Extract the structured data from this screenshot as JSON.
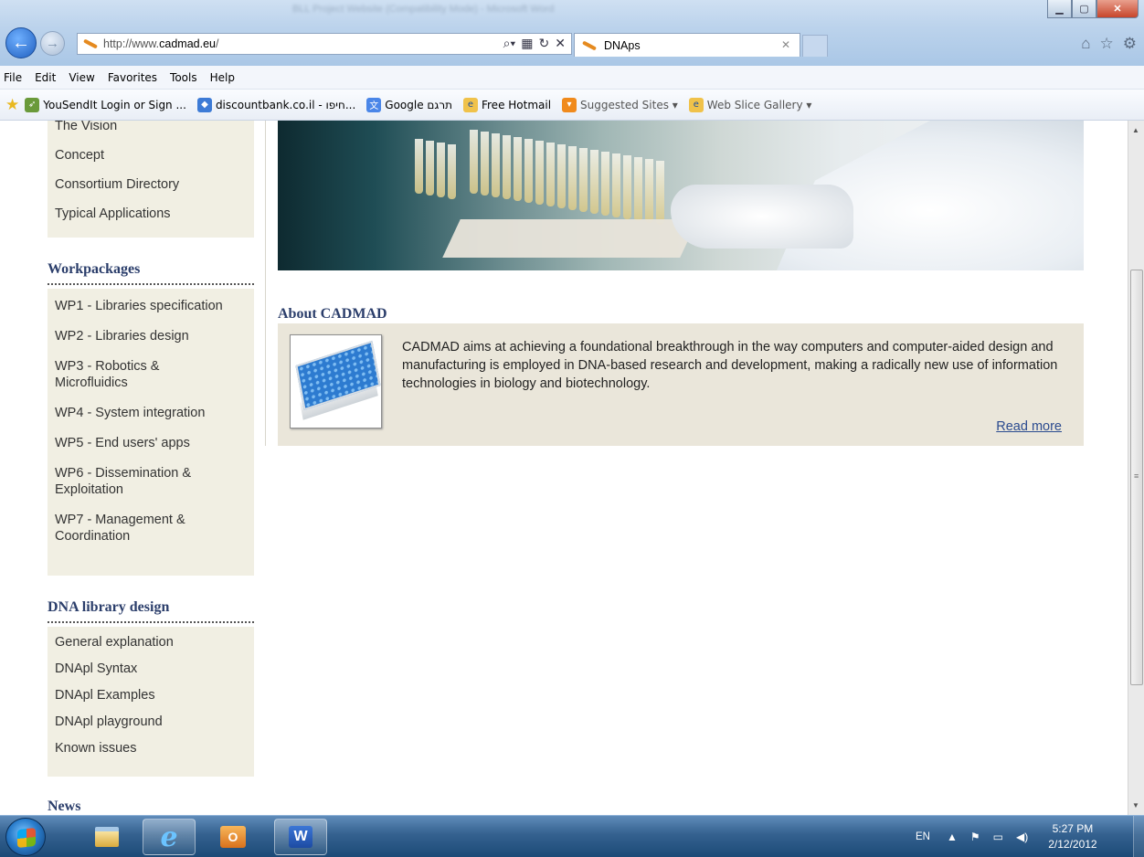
{
  "browser": {
    "window_title": "BLL Project Website (Compatibility Mode) - Microsoft Word",
    "address": {
      "prefix": "http://www.",
      "domain": "cadmad.eu",
      "suffix": "/"
    },
    "tab_title": "DNAps",
    "menu": [
      "File",
      "Edit",
      "View",
      "Favorites",
      "Tools",
      "Help"
    ],
    "favorites": [
      {
        "label": "YouSendIt Login or Sign ...",
        "icon": "yousendit-icon"
      },
      {
        "label": "discountbank.co.il - חיפו...",
        "icon": "discountbank-icon"
      },
      {
        "label": "Google תרגם",
        "icon": "google-translate-icon"
      },
      {
        "label": "Free Hotmail",
        "icon": "ie-page-icon"
      },
      {
        "label": "Suggested Sites ▾",
        "icon": "suggested-sites-icon"
      },
      {
        "label": "Web Slice Gallery ▾",
        "icon": "ie-page-icon"
      }
    ]
  },
  "sidebar": {
    "intro_links": [
      "The Vision",
      "Concept",
      "Consortium Directory",
      "Typical Applications"
    ],
    "workpackages": {
      "title": "Workpackages",
      "links": [
        "WP1 - Libraries specification",
        "WP2 - Libraries design",
        "WP3 - Robotics & Microfluidics",
        "WP4 - System integration",
        "WP5 - End users' apps",
        "WP6 - Dissemination & Exploitation",
        "WP7 - Management & Coordination"
      ]
    },
    "dna": {
      "title": "DNA library design",
      "links": [
        "General explanation",
        "DNApl Syntax",
        "DNApl Examples",
        "DNApl playground",
        "Known issues"
      ]
    },
    "news_title": "News"
  },
  "main": {
    "about_title": "About CADMAD",
    "about_text": "CADMAD aims at achieving a foundational breakthrough in the way computers and computer-aided design and manufacturing is employed in DNA-based research and development, making a radically new use of information technologies in biology and biotechnology.",
    "read_more": "Read more"
  },
  "taskbar": {
    "lang": "EN",
    "time": "5:27 PM",
    "date": "2/12/2012"
  }
}
